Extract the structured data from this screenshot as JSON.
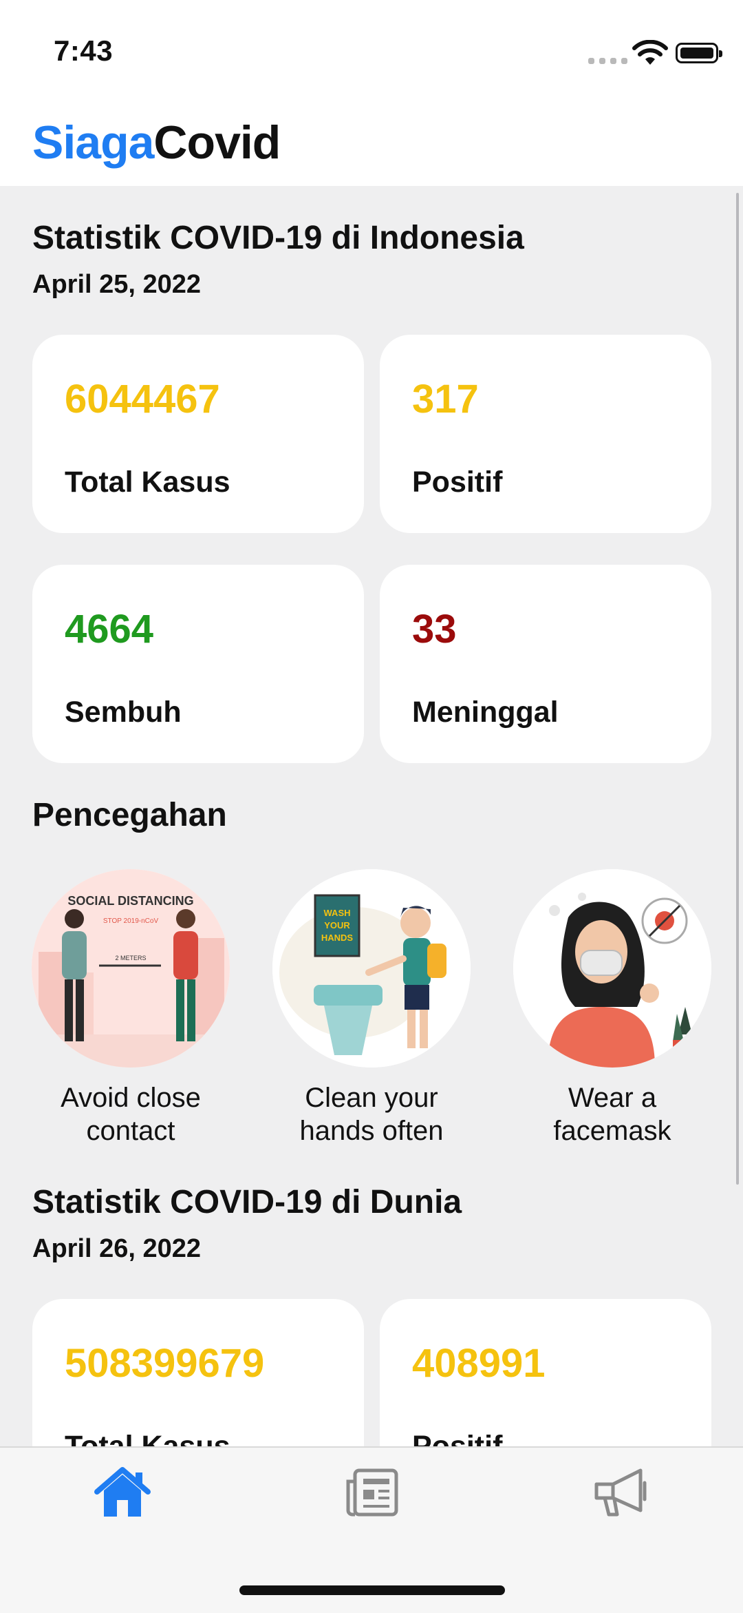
{
  "status": {
    "time": "7:43"
  },
  "app": {
    "title_part1": "Siaga",
    "title_part2": "Covid"
  },
  "indonesia": {
    "title": "Statistik COVID-19 di Indonesia",
    "date": "April 25, 2022",
    "stats": [
      {
        "value": "6044467",
        "label": "Total Kasus"
      },
      {
        "value": "317",
        "label": "Positif"
      },
      {
        "value": "4664",
        "label": "Sembuh"
      },
      {
        "value": "33",
        "label": "Meninggal"
      }
    ]
  },
  "prevention": {
    "title": "Pencegahan",
    "items": [
      {
        "label": "Avoid close contact",
        "line1": "Avoid close",
        "line2": "contact",
        "image_text": "SOCIAL DISTANCING",
        "image_sub": "STOP 2019-nCoV",
        "image_meter": "2 METERS"
      },
      {
        "label": "Clean your hands often",
        "line1": "Clean your",
        "line2": "hands often",
        "image_text1": "WASH",
        "image_text2": "YOUR",
        "image_text3": "HANDS"
      },
      {
        "label": "Wear a facemask",
        "line1": "Wear a",
        "line2": "facemask"
      }
    ]
  },
  "world": {
    "title": "Statistik COVID-19 di Dunia",
    "date": "April 26, 2022",
    "stats": [
      {
        "value": "508399679",
        "label": "Total Kasus"
      },
      {
        "value": "408991",
        "label": "Positif"
      }
    ]
  },
  "tabs": [
    {
      "name": "home",
      "icon": "home-icon"
    },
    {
      "name": "news",
      "icon": "newspaper-icon"
    },
    {
      "name": "announcements",
      "icon": "megaphone-icon"
    }
  ],
  "colors": {
    "brand": "#1f7df2",
    "yellow": "#f5c20f",
    "green": "#1f9a1f",
    "red": "#9b0b0b"
  }
}
